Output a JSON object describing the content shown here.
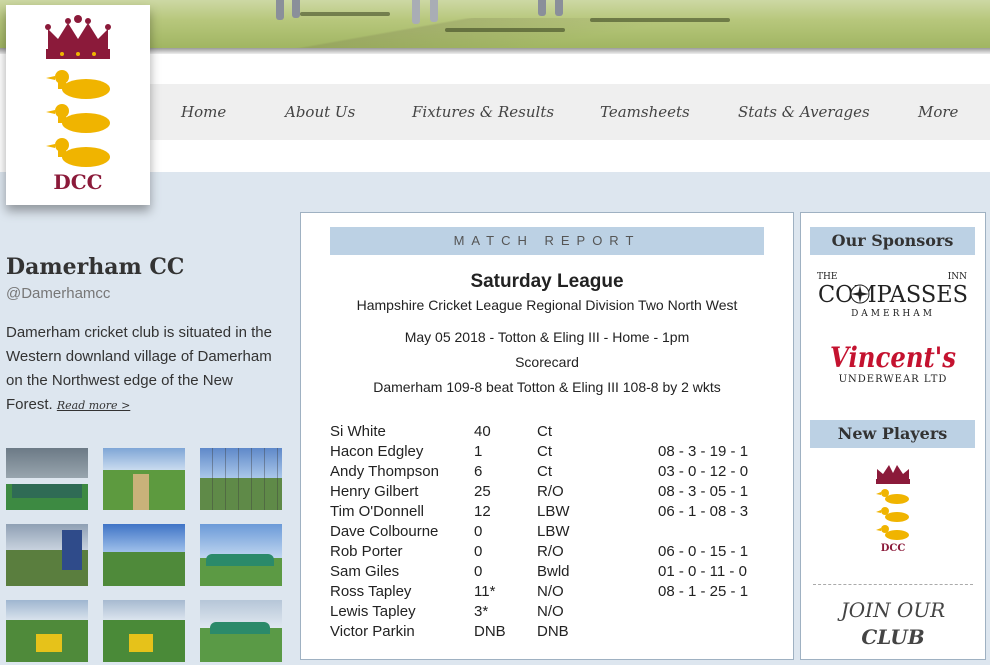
{
  "nav": {
    "items": [
      {
        "label": "Home"
      },
      {
        "label": "About Us"
      },
      {
        "label": "Fixtures & Results"
      },
      {
        "label": "Teamsheets"
      },
      {
        "label": "Stats & Averages"
      },
      {
        "label": "More"
      }
    ]
  },
  "logo": {
    "text": "DCC"
  },
  "club": {
    "name": "Damerham CC",
    "handle": "@Damerhamcc",
    "blurb": "Damerham cricket club is situated in the Western downland village of Damerham on the Northwest edge of the New Forest.",
    "read_more": "Read more >"
  },
  "report": {
    "heading": "MATCH REPORT",
    "title": "Saturday League",
    "league": "Hampshire Cricket League Regional Division Two North West",
    "fixture": "May 05 2018 - Totton & Eling III - Home - 1pm",
    "scorecard": "Scorecard",
    "result": "Damerham 109-8 beat Totton & Eling III 108-8 by 2 wkts",
    "rows": [
      {
        "name": "Si White",
        "runs": "40",
        "how": "Ct",
        "bowling": ""
      },
      {
        "name": "Hacon Edgley",
        "runs": "1",
        "how": "Ct",
        "bowling": "08 - 3 - 19 - 1"
      },
      {
        "name": "Andy Thompson",
        "runs": "6",
        "how": "Ct",
        "bowling": "03 - 0 - 12 - 0"
      },
      {
        "name": "Henry Gilbert",
        "runs": "25",
        "how": "R/O",
        "bowling": "08 - 3 - 05 - 1"
      },
      {
        "name": "Tim O'Donnell",
        "runs": "12",
        "how": "LBW",
        "bowling": "06 - 1 - 08 - 3"
      },
      {
        "name": "Dave Colbourne",
        "runs": "0",
        "how": "LBW",
        "bowling": ""
      },
      {
        "name": "Rob Porter",
        "runs": "0",
        "how": "R/O",
        "bowling": "06 - 0 - 15 - 1"
      },
      {
        "name": "Sam Giles",
        "runs": "0",
        "how": "Bwld",
        "bowling": "01 - 0 - 11 - 0"
      },
      {
        "name": "Ross Tapley",
        "runs": "11*",
        "how": "N/O",
        "bowling": "08 - 1 - 25 - 1"
      },
      {
        "name": "Lewis Tapley",
        "runs": "3*",
        "how": "N/O",
        "bowling": ""
      },
      {
        "name": "Victor Parkin",
        "runs": "DNB",
        "how": "DNB",
        "bowling": ""
      }
    ]
  },
  "sidebar": {
    "sponsors_heading": "Our Sponsors",
    "sponsor1": {
      "the": "THE",
      "inn": "INN",
      "name": "COMPASSES",
      "sub": "DAMERHAM"
    },
    "sponsor2": {
      "name": "Vincent's",
      "sub": "UNDERWEAR LTD"
    },
    "new_players_heading": "New Players",
    "logo_text": "DCC",
    "join_line1": "JOIN OUR",
    "join_line2": "CLUB"
  },
  "colors": {
    "page_bg": "#dde6ef",
    "panel_heading": "#bcd1e4",
    "crown": "#8b1a3a",
    "duck": "#f0b400",
    "dcc_text": "#8b1a3a",
    "vincents_red": "#c4122f"
  },
  "icons": [
    "crown-icon",
    "duck-icon",
    "compass-icon"
  ]
}
